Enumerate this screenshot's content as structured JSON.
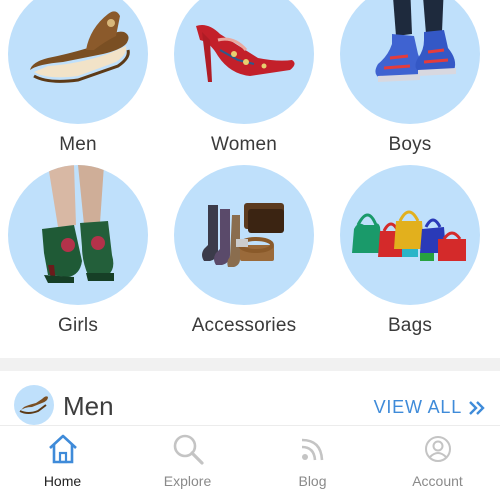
{
  "categories": [
    {
      "label": "Men",
      "image": "sandal"
    },
    {
      "label": "Women",
      "image": "high-heel"
    },
    {
      "label": "Boys",
      "image": "sneakers"
    },
    {
      "label": "Girls",
      "image": "platform-heels"
    },
    {
      "label": "Accessories",
      "image": "socks-wallets-belts"
    },
    {
      "label": "Bags",
      "image": "handbags"
    }
  ],
  "section": {
    "title": "Men",
    "view_all": "VIEW ALL",
    "view_all_icon": "double-chevron-right-icon"
  },
  "bottom_nav": {
    "active": "Home",
    "items": [
      {
        "label": "Home",
        "icon": "home-icon"
      },
      {
        "label": "Explore",
        "icon": "search-icon"
      },
      {
        "label": "Blog",
        "icon": "feed-icon"
      },
      {
        "label": "Account",
        "icon": "user-icon"
      }
    ]
  },
  "colors": {
    "circle_bg": "#bfe0fb",
    "accent": "#3f8bd9",
    "separator": "#f1f1f1"
  }
}
